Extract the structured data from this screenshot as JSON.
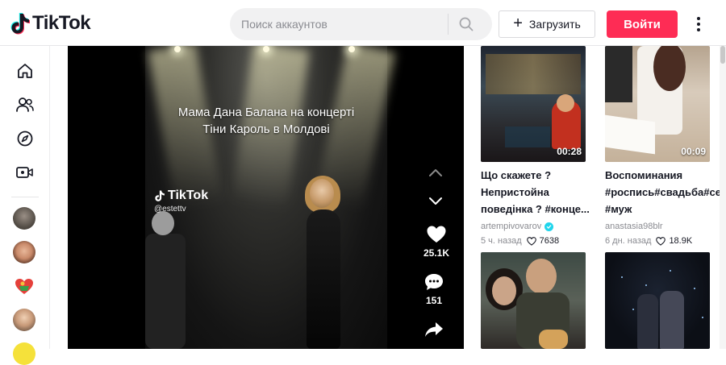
{
  "header": {
    "logo_text": "TikTok",
    "search_placeholder": "Поиск аккаунтов",
    "upload_label": "Загрузить",
    "login_label": "Войти"
  },
  "sidebar": {
    "items": [
      {
        "icon": "home-icon"
      },
      {
        "icon": "following-icon"
      },
      {
        "icon": "explore-icon"
      },
      {
        "icon": "live-icon"
      }
    ]
  },
  "player": {
    "caption_line1": "Мама Дана Балана на концерті",
    "caption_line2": "Тіни Кароль в Молдові",
    "watermark_logo": "TikTok",
    "watermark_handle": "@estettv",
    "likes": "25.1K",
    "comments": "151"
  },
  "videos": [
    {
      "title": "Що скажете ? Непристойна поведінка ? #конце...",
      "author": "artempivovarov",
      "verified": true,
      "posted": "5 ч. назад",
      "likes": "7638",
      "duration": "00:28"
    },
    {
      "title": "Воспоминания  #роспись#свадьба#семья #муж",
      "author": "anastasia98blr",
      "verified": false,
      "posted": "6 дн. назад",
      "likes": "18.9K",
      "duration": "00:09"
    },
    {
      "title": "",
      "author": "",
      "posted": "",
      "likes": "",
      "duration": ""
    },
    {
      "title": "",
      "author": "",
      "posted": "",
      "likes": "",
      "duration": ""
    }
  ],
  "colors": {
    "accent": "#fe2c55",
    "verified": "#20d5ec",
    "text": "#161823",
    "muted": "#8a8b91"
  }
}
